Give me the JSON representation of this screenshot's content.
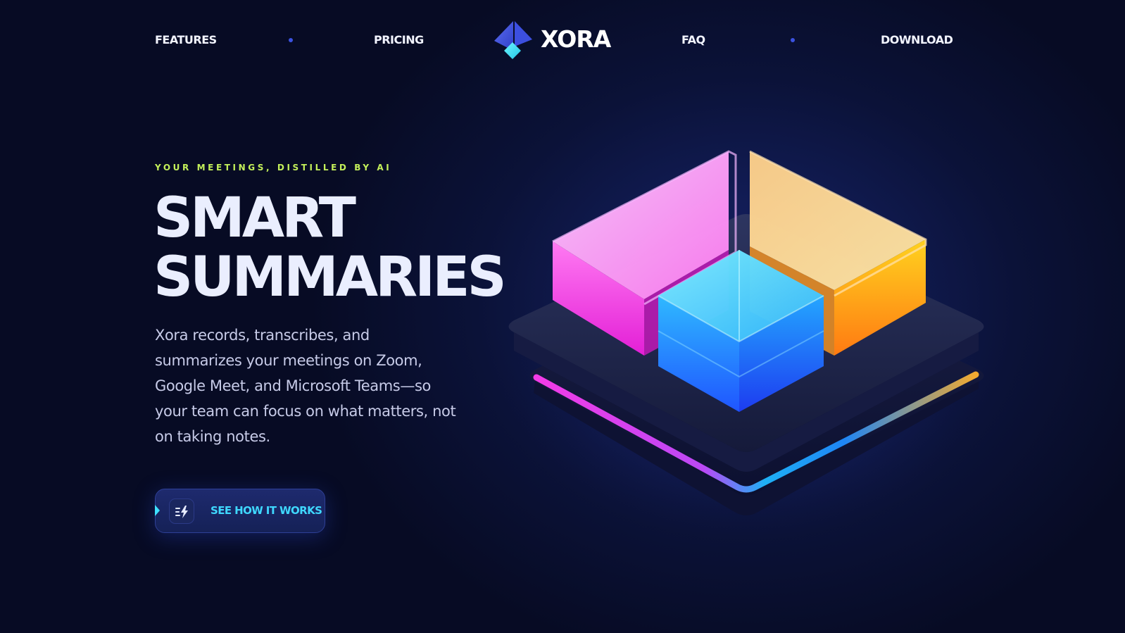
{
  "nav": {
    "links": [
      {
        "label": "FEATURES"
      },
      {
        "label": "PRICING"
      },
      {
        "label": "FAQ"
      },
      {
        "label": "DOWNLOAD"
      }
    ],
    "logo_text": "XORA",
    "dot_color": "#3b52e0"
  },
  "hero": {
    "eyebrow": "YOUR MEETINGS, DISTILLED BY AI",
    "headline_line1": "SMART",
    "headline_line2": "SUMMARIES",
    "description": "Xora records, transcribes, and summarizes your meetings on Zoom, Google Meet, and Microsoft Teams—so your team can focus on what matters, not on taking notes.",
    "cta_label": "SEE HOW IT WORKS",
    "cta_icon": "bolt-list-icon"
  },
  "colors": {
    "background": "#0b1238",
    "accent_lime": "#c4f05a",
    "accent_cyan": "#3fd8ff",
    "brand_blue": "#3b52e0",
    "illustration_magenta": "#ff3df0",
    "illustration_orange": "#ffb22e",
    "illustration_blue": "#1f8bff"
  },
  "illustration": {
    "name": "isometric-glass-blocks-icon"
  }
}
